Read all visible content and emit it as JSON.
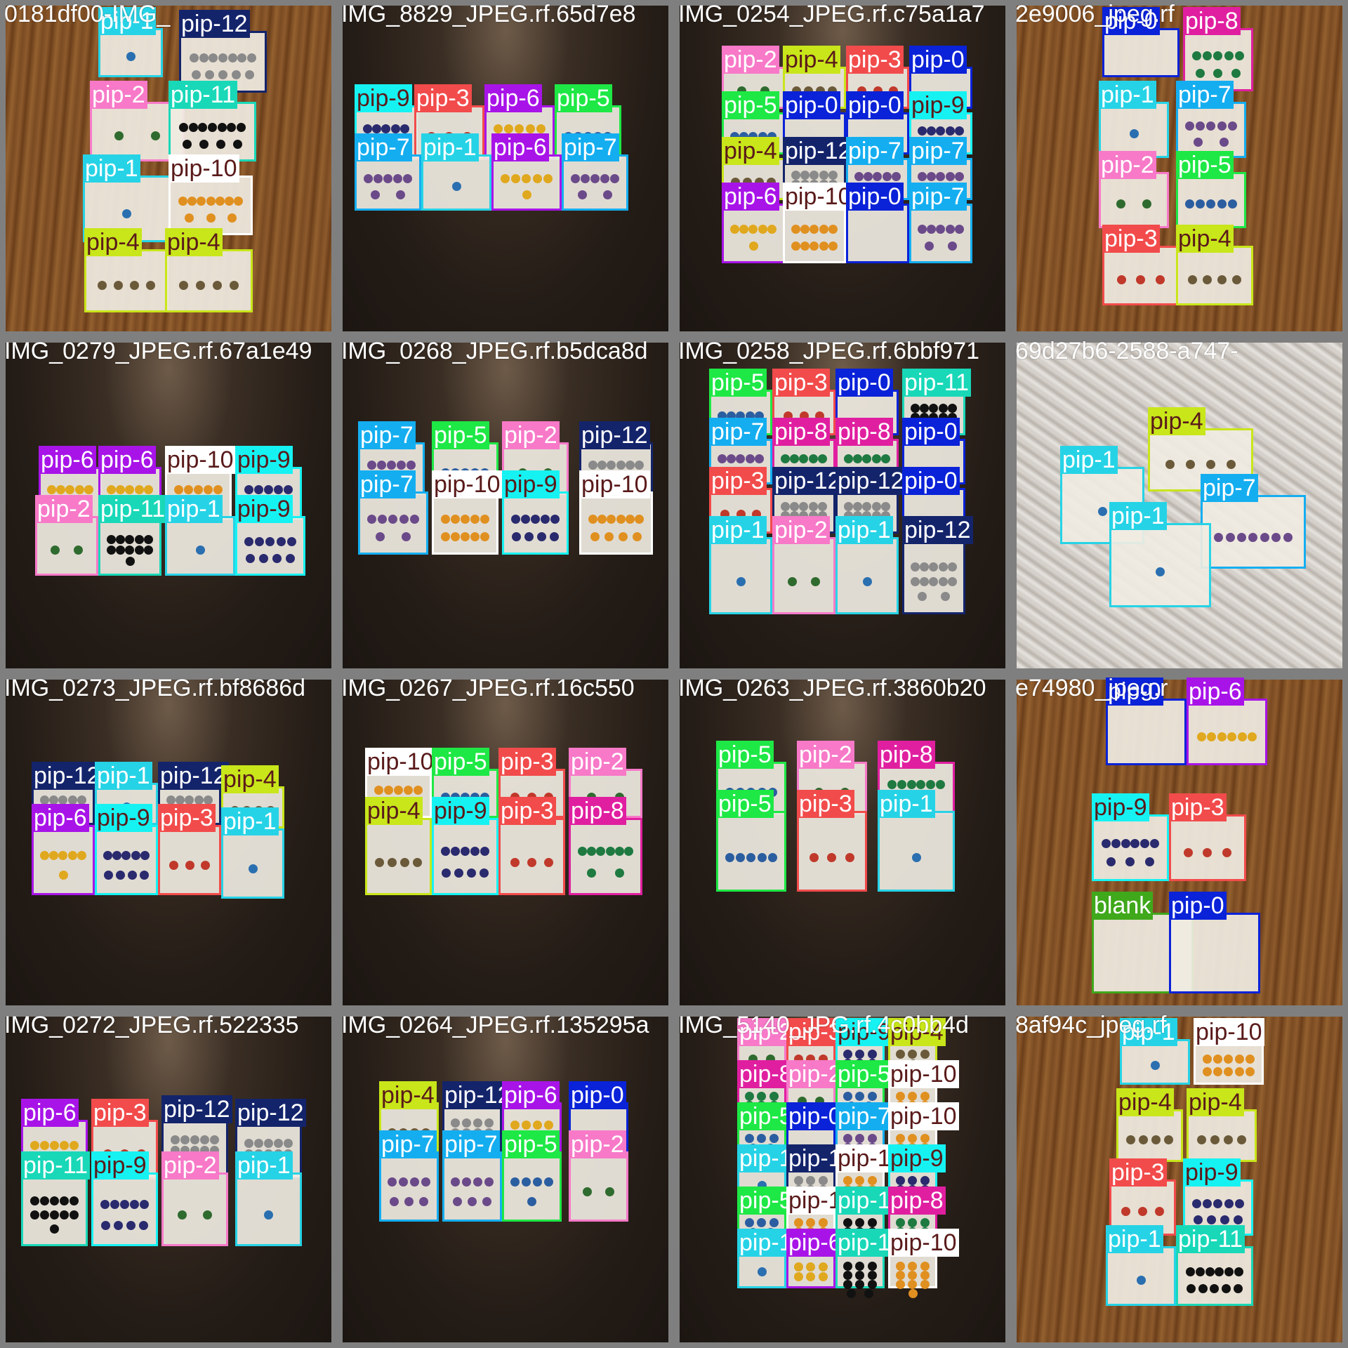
{
  "tiles": [
    {
      "filename": "0181df00-IMG_",
      "bg": "wood",
      "dets": [
        {
          "label": "pip-1",
          "color": "#26d3e6"
        },
        {
          "label": "pip-12",
          "color": "#14246b"
        },
        {
          "label": "pip-2",
          "color": "#f779c8"
        },
        {
          "label": "pip-11",
          "color": "#18d8b8"
        },
        {
          "label": "pip-1",
          "color": "#26d3e6"
        },
        {
          "label": "pip-10",
          "color": "#ffffff"
        },
        {
          "label": "pip-4",
          "color": "#c8e61a"
        },
        {
          "label": "pip-4",
          "color": "#c8e61a"
        }
      ]
    },
    {
      "filename": "IMG_8829_JPEG.rf.65d7e8",
      "bg": "dark",
      "dets": [
        {
          "label": "pip-9",
          "color": "#16f2f2"
        },
        {
          "label": "pip-3",
          "color": "#f24b4b"
        },
        {
          "label": "pip-6",
          "color": "#a814e8"
        },
        {
          "label": "pip-5",
          "color": "#1ee845"
        },
        {
          "label": "pip-7",
          "color": "#14aef0"
        },
        {
          "label": "pip-1",
          "color": "#26d3e6"
        },
        {
          "label": "pip-6",
          "color": "#a814e8"
        },
        {
          "label": "pip-7",
          "color": "#14aef0"
        }
      ]
    },
    {
      "filename": "IMG_0254_JPEG.rf.c75a1a7",
      "bg": "dark",
      "dets": [
        {
          "label": "pip-2",
          "color": "#f779c8"
        },
        {
          "label": "pip-4",
          "color": "#c8e61a"
        },
        {
          "label": "pip-3",
          "color": "#f24b4b"
        },
        {
          "label": "pip-0",
          "color": "#0a22d8"
        },
        {
          "label": "pip-5",
          "color": "#1ee845"
        },
        {
          "label": "pip-0",
          "color": "#0a22d8"
        },
        {
          "label": "pip-0",
          "color": "#0a22d8"
        },
        {
          "label": "pip-9",
          "color": "#16f2f2"
        },
        {
          "label": "pip-4",
          "color": "#c8e61a"
        },
        {
          "label": "pip-12",
          "color": "#14246b"
        },
        {
          "label": "pip-7",
          "color": "#14aef0"
        },
        {
          "label": "pip-7",
          "color": "#14aef0"
        },
        {
          "label": "pip-6",
          "color": "#a814e8"
        },
        {
          "label": "pip-10",
          "color": "#ffffff"
        },
        {
          "label": "pip-0",
          "color": "#0a22d8"
        },
        {
          "label": "pip-7",
          "color": "#14aef0"
        }
      ]
    },
    {
      "filename": "2e9006_jpeg.rf",
      "bg": "wood",
      "dets": [
        {
          "label": "pip-0",
          "color": "#0a22d8"
        },
        {
          "label": "pip-8",
          "color": "#e01fa0"
        },
        {
          "label": "pip-1",
          "color": "#26d3e6"
        },
        {
          "label": "pip-7",
          "color": "#14aef0"
        },
        {
          "label": "pip-2",
          "color": "#f779c8"
        },
        {
          "label": "pip-5",
          "color": "#1ee845"
        },
        {
          "label": "pip-3",
          "color": "#f24b4b"
        },
        {
          "label": "pip-4",
          "color": "#c8e61a"
        }
      ]
    },
    {
      "filename": "IMG_0279_JPEG.rf.67a1e49",
      "bg": "dark",
      "dets": [
        {
          "label": "pip-6",
          "color": "#a814e8"
        },
        {
          "label": "pip-6",
          "color": "#a814e8"
        },
        {
          "label": "pip-10",
          "color": "#ffffff"
        },
        {
          "label": "pip-9",
          "color": "#16f2f2"
        },
        {
          "label": "pip-2",
          "color": "#f779c8"
        },
        {
          "label": "pip-11",
          "color": "#18d8b8"
        },
        {
          "label": "pip-1",
          "color": "#26d3e6"
        },
        {
          "label": "pip-9",
          "color": "#16f2f2"
        }
      ]
    },
    {
      "filename": "IMG_0268_JPEG.rf.b5dca8d",
      "bg": "dark",
      "dets": [
        {
          "label": "pip-7",
          "color": "#14aef0"
        },
        {
          "label": "pip-5",
          "color": "#1ee845"
        },
        {
          "label": "pip-2",
          "color": "#f779c8"
        },
        {
          "label": "pip-12",
          "color": "#14246b"
        },
        {
          "label": "pip-7",
          "color": "#14aef0"
        },
        {
          "label": "pip-10",
          "color": "#ffffff"
        },
        {
          "label": "pip-9",
          "color": "#16f2f2"
        },
        {
          "label": "pip-10",
          "color": "#ffffff"
        }
      ]
    },
    {
      "filename": "IMG_0258_JPEG.rf.6bbf971",
      "bg": "dark",
      "dets": [
        {
          "label": "pip-5",
          "color": "#1ee845"
        },
        {
          "label": "pip-3",
          "color": "#f24b4b"
        },
        {
          "label": "pip-0",
          "color": "#0a22d8"
        },
        {
          "label": "pip-11",
          "color": "#18d8b8"
        },
        {
          "label": "pip-7",
          "color": "#14aef0"
        },
        {
          "label": "pip-8",
          "color": "#e01fa0"
        },
        {
          "label": "pip-8",
          "color": "#e01fa0"
        },
        {
          "label": "pip-0",
          "color": "#0a22d8"
        },
        {
          "label": "pip-3",
          "color": "#f24b4b"
        },
        {
          "label": "pip-12",
          "color": "#14246b"
        },
        {
          "label": "pip-12",
          "color": "#14246b"
        },
        {
          "label": "pip-0",
          "color": "#0a22d8"
        },
        {
          "label": "pip-1",
          "color": "#26d3e6"
        },
        {
          "label": "pip-2",
          "color": "#f779c8"
        },
        {
          "label": "pip-1",
          "color": "#26d3e6"
        },
        {
          "label": "pip-12",
          "color": "#14246b"
        }
      ]
    },
    {
      "filename": "69d27b6-2588-a747-",
      "bg": "marble",
      "dets": [
        {
          "label": "pip-4",
          "color": "#c8e61a"
        },
        {
          "label": "pip-1",
          "color": "#26d3e6"
        },
        {
          "label": "pip-7",
          "color": "#14aef0"
        },
        {
          "label": "pip-1",
          "color": "#26d3e6"
        }
      ]
    },
    {
      "filename": "IMG_0273_JPEG.rf.bf8686d",
      "bg": "dark",
      "dets": [
        {
          "label": "pip-12",
          "color": "#14246b"
        },
        {
          "label": "pip-1",
          "color": "#26d3e6"
        },
        {
          "label": "pip-12",
          "color": "#14246b"
        },
        {
          "label": "pip-4",
          "color": "#c8e61a"
        },
        {
          "label": "pip-6",
          "color": "#a814e8"
        },
        {
          "label": "pip-9",
          "color": "#16f2f2"
        },
        {
          "label": "pip-3",
          "color": "#f24b4b"
        },
        {
          "label": "pip-1",
          "color": "#26d3e6"
        }
      ]
    },
    {
      "filename": "IMG_0267_JPEG.rf.16c550",
      "bg": "dark",
      "dets": [
        {
          "label": "pip-10",
          "color": "#ffffff"
        },
        {
          "label": "pip-5",
          "color": "#1ee845"
        },
        {
          "label": "pip-3",
          "color": "#f24b4b"
        },
        {
          "label": "pip-2",
          "color": "#f779c8"
        },
        {
          "label": "pip-4",
          "color": "#c8e61a"
        },
        {
          "label": "pip-9",
          "color": "#16f2f2"
        },
        {
          "label": "pip-3",
          "color": "#f24b4b"
        },
        {
          "label": "pip-8",
          "color": "#e01fa0"
        }
      ]
    },
    {
      "filename": "IMG_0263_JPEG.rf.3860b20",
      "bg": "dark",
      "dets": [
        {
          "label": "pip-5",
          "color": "#1ee845"
        },
        {
          "label": "pip-2",
          "color": "#f779c8"
        },
        {
          "label": "pip-8",
          "color": "#e01fa0"
        },
        {
          "label": "pip-5",
          "color": "#1ee845"
        },
        {
          "label": "pip-3",
          "color": "#f24b4b"
        },
        {
          "label": "pip-1",
          "color": "#26d3e6"
        }
      ]
    },
    {
      "filename": "e74980_jpeg.r",
      "bg": "wood",
      "dets": [
        {
          "label": "pip-0",
          "color": "#0a22d8"
        },
        {
          "label": "pip-6",
          "color": "#a814e8"
        },
        {
          "label": "pip-9",
          "color": "#16f2f2"
        },
        {
          "label": "pip-3",
          "color": "#f24b4b"
        },
        {
          "label": "blank",
          "color": "#3fa81b"
        },
        {
          "label": "pip-0",
          "color": "#0a22d8"
        }
      ]
    },
    {
      "filename": "IMG_0272_JPEG.rf.522335",
      "bg": "dark",
      "dets": [
        {
          "label": "pip-6",
          "color": "#a814e8"
        },
        {
          "label": "pip-3",
          "color": "#f24b4b"
        },
        {
          "label": "pip-12",
          "color": "#14246b"
        },
        {
          "label": "pip-12",
          "color": "#14246b"
        },
        {
          "label": "pip-11",
          "color": "#18d8b8"
        },
        {
          "label": "pip-9",
          "color": "#16f2f2"
        },
        {
          "label": "pip-2",
          "color": "#f779c8"
        },
        {
          "label": "pip-1",
          "color": "#26d3e6"
        }
      ]
    },
    {
      "filename": "IMG_0264_JPEG.rf.135295a",
      "bg": "dark",
      "dets": [
        {
          "label": "pip-4",
          "color": "#c8e61a"
        },
        {
          "label": "pip-12",
          "color": "#14246b"
        },
        {
          "label": "pip-6",
          "color": "#a814e8"
        },
        {
          "label": "pip-0",
          "color": "#0a22d8"
        },
        {
          "label": "pip-7",
          "color": "#14aef0"
        },
        {
          "label": "pip-7",
          "color": "#14aef0"
        },
        {
          "label": "pip-5",
          "color": "#1ee845"
        },
        {
          "label": "pip-2",
          "color": "#f779c8"
        }
      ]
    },
    {
      "filename": "IMG_5140_JPG.rf.4c0bb4d",
      "bg": "dark",
      "dets": [
        {
          "label": "pip-2",
          "color": "#f779c8"
        },
        {
          "label": "pip-3",
          "color": "#f24b4b"
        },
        {
          "label": "pip-9",
          "color": "#16f2f2"
        },
        {
          "label": "pip-4",
          "color": "#c8e61a"
        },
        {
          "label": "pip-8",
          "color": "#e01fa0"
        },
        {
          "label": "pip-2",
          "color": "#f779c8"
        },
        {
          "label": "pip-5",
          "color": "#1ee845"
        },
        {
          "label": "pip-10",
          "color": "#ffffff"
        },
        {
          "label": "pip-5",
          "color": "#1ee845"
        },
        {
          "label": "pip-0",
          "color": "#0a22d8"
        },
        {
          "label": "pip-7",
          "color": "#14aef0"
        },
        {
          "label": "pip-10",
          "color": "#ffffff"
        },
        {
          "label": "pip-1",
          "color": "#26d3e6"
        },
        {
          "label": "pip-12",
          "color": "#14246b"
        },
        {
          "label": "pip-10",
          "color": "#ffffff"
        },
        {
          "label": "pip-9",
          "color": "#16f2f2"
        },
        {
          "label": "pip-5",
          "color": "#1ee845"
        },
        {
          "label": "pip-10",
          "color": "#ffffff"
        },
        {
          "label": "pip-11",
          "color": "#18d8b8"
        },
        {
          "label": "pip-8",
          "color": "#e01fa0"
        },
        {
          "label": "pip-1",
          "color": "#26d3e6"
        },
        {
          "label": "pip-6",
          "color": "#a814e8"
        },
        {
          "label": "pip-11",
          "color": "#18d8b8"
        },
        {
          "label": "pip-10",
          "color": "#ffffff"
        }
      ]
    },
    {
      "filename": "8af94c_jpeg.rf",
      "bg": "wood",
      "dets": [
        {
          "label": "pip-1",
          "color": "#26d3e6"
        },
        {
          "label": "pip-10",
          "color": "#ffffff"
        },
        {
          "label": "pip-4",
          "color": "#c8e61a"
        },
        {
          "label": "pip-4",
          "color": "#c8e61a"
        },
        {
          "label": "pip-3",
          "color": "#f24b4b"
        },
        {
          "label": "pip-9",
          "color": "#16f2f2"
        },
        {
          "label": "pip-1",
          "color": "#26d3e6"
        },
        {
          "label": "pip-11",
          "color": "#18d8b8"
        }
      ]
    }
  ]
}
